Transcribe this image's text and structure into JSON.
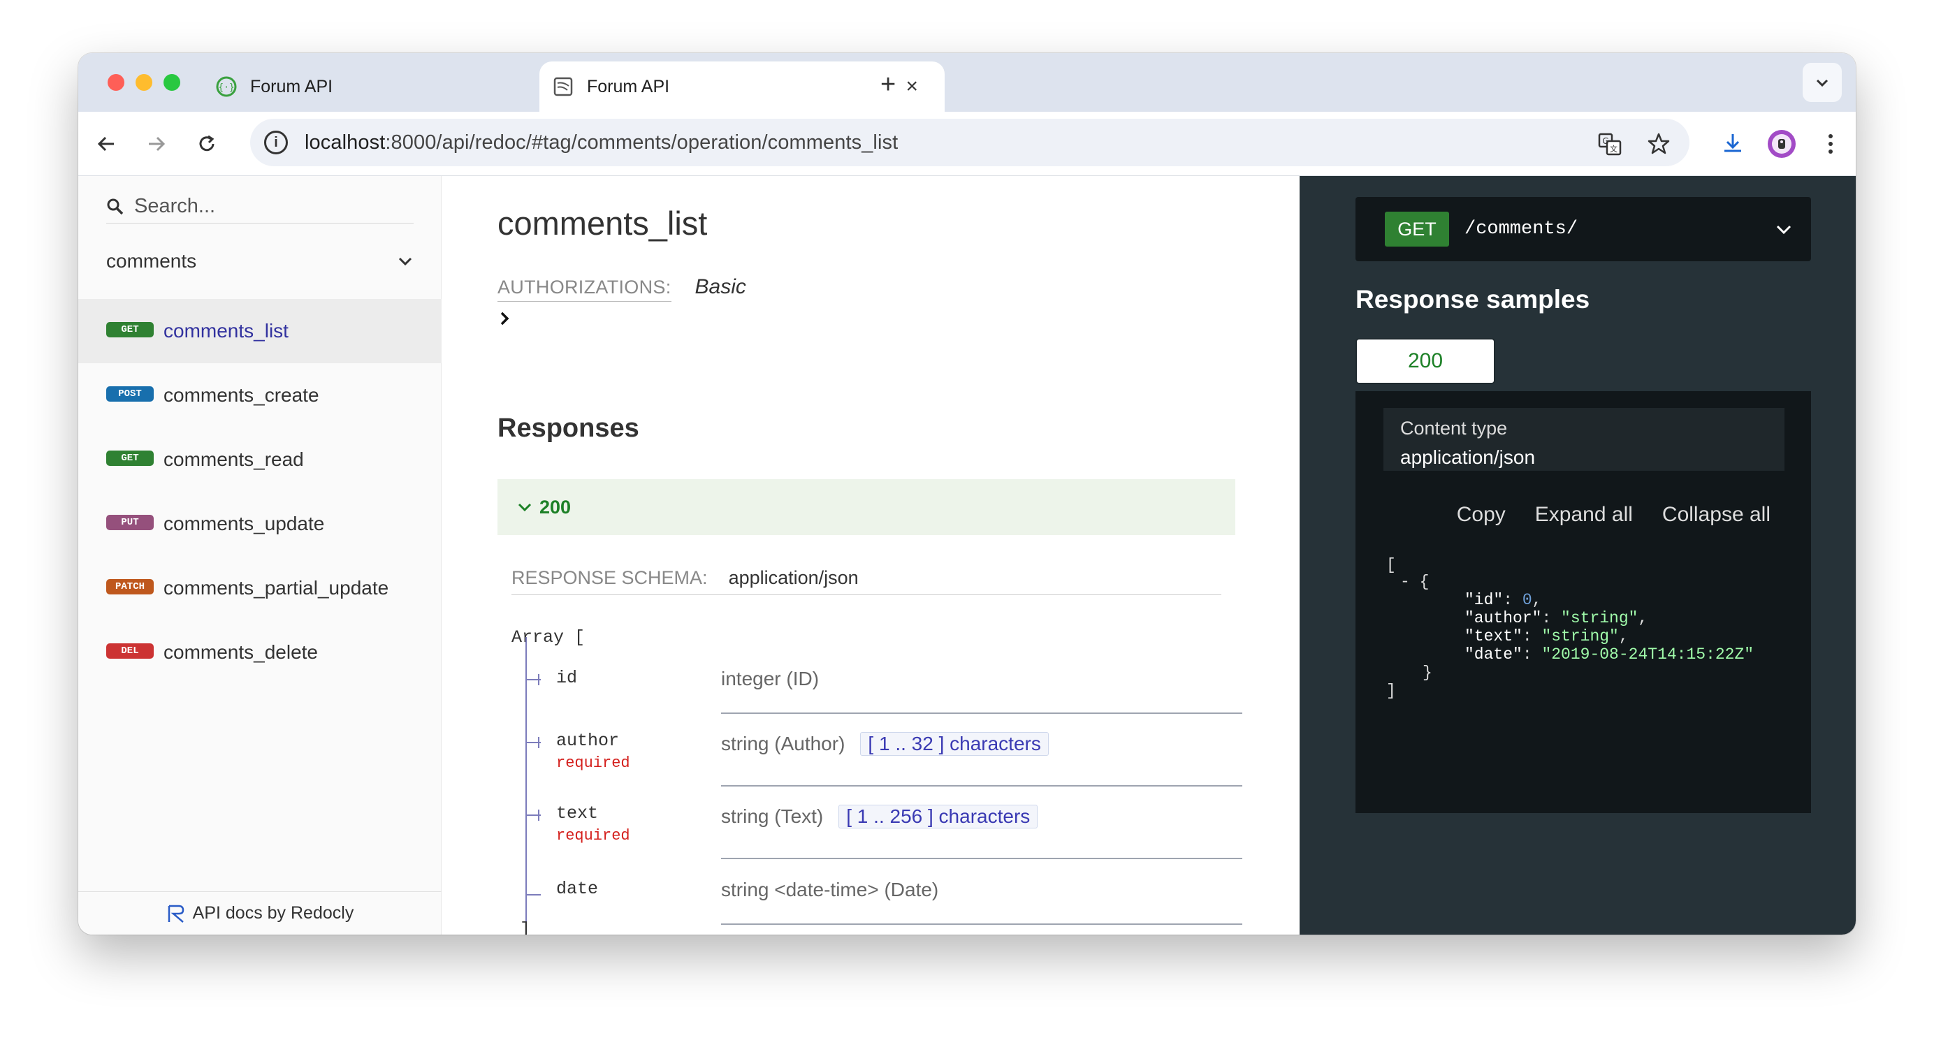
{
  "browser": {
    "tabs": [
      {
        "title": "Forum API",
        "active": false
      },
      {
        "title": "Forum API",
        "active": true
      }
    ],
    "new_tab": "+",
    "url_host": "localhost",
    "url_path": ":8000/api/redoc/#tag/comments/operation/comments_list"
  },
  "sidebar": {
    "search_placeholder": "Search...",
    "group": "comments",
    "items": [
      {
        "method": "GET",
        "label": "comments_list",
        "active": true
      },
      {
        "method": "POST",
        "label": "comments_create",
        "active": false
      },
      {
        "method": "GET",
        "label": "comments_read",
        "active": false
      },
      {
        "method": "PUT",
        "label": "comments_update",
        "active": false
      },
      {
        "method": "PATCH",
        "label": "comments_partial_update",
        "active": false
      },
      {
        "method": "DEL",
        "label": "comments_delete",
        "active": false
      }
    ],
    "footer": "API docs by Redocly"
  },
  "operation": {
    "title": "comments_list",
    "auth_label": "AUTHORIZATIONS:",
    "auth_value": "Basic",
    "responses_title": "Responses",
    "response_code": "200",
    "schema_label": "RESPONSE SCHEMA:",
    "schema_value": "application/json",
    "array_open": "Array [",
    "array_close": "]",
    "properties": [
      {
        "name": "id",
        "required": "",
        "type": "integer (ID)",
        "constraint": ""
      },
      {
        "name": "author",
        "required": "required",
        "type": "string (Author)",
        "constraint": "[ 1 .. 32 ] characters"
      },
      {
        "name": "text",
        "required": "required",
        "type": "string (Text)",
        "constraint": "[ 1 .. 256 ] characters"
      },
      {
        "name": "date",
        "required": "",
        "type": "string <date-time> (Date)",
        "constraint": ""
      }
    ]
  },
  "samples": {
    "method": "GET",
    "path": "/comments/",
    "title": "Response samples",
    "status": "200",
    "content_type_label": "Content type",
    "content_type": "application/json",
    "actions": [
      "Copy",
      "Expand all",
      "Collapse all"
    ],
    "code": {
      "open": "[",
      "obj_open": "- {",
      "id_key": "\"id\"",
      "id_val": "0",
      "author_key": "\"author\"",
      "author_val": "\"string\"",
      "text_key": "\"text\"",
      "text_val": "\"string\"",
      "date_key": "\"date\"",
      "date_val": "\"2019-08-24T14:15:22Z\"",
      "obj_close": "}",
      "close": "]"
    }
  },
  "colors": {
    "get": "#2f8132",
    "post": "#186fad",
    "put": "#95507c",
    "patch": "#bf581d",
    "del": "#cc3333",
    "right_panel": "#263238"
  }
}
